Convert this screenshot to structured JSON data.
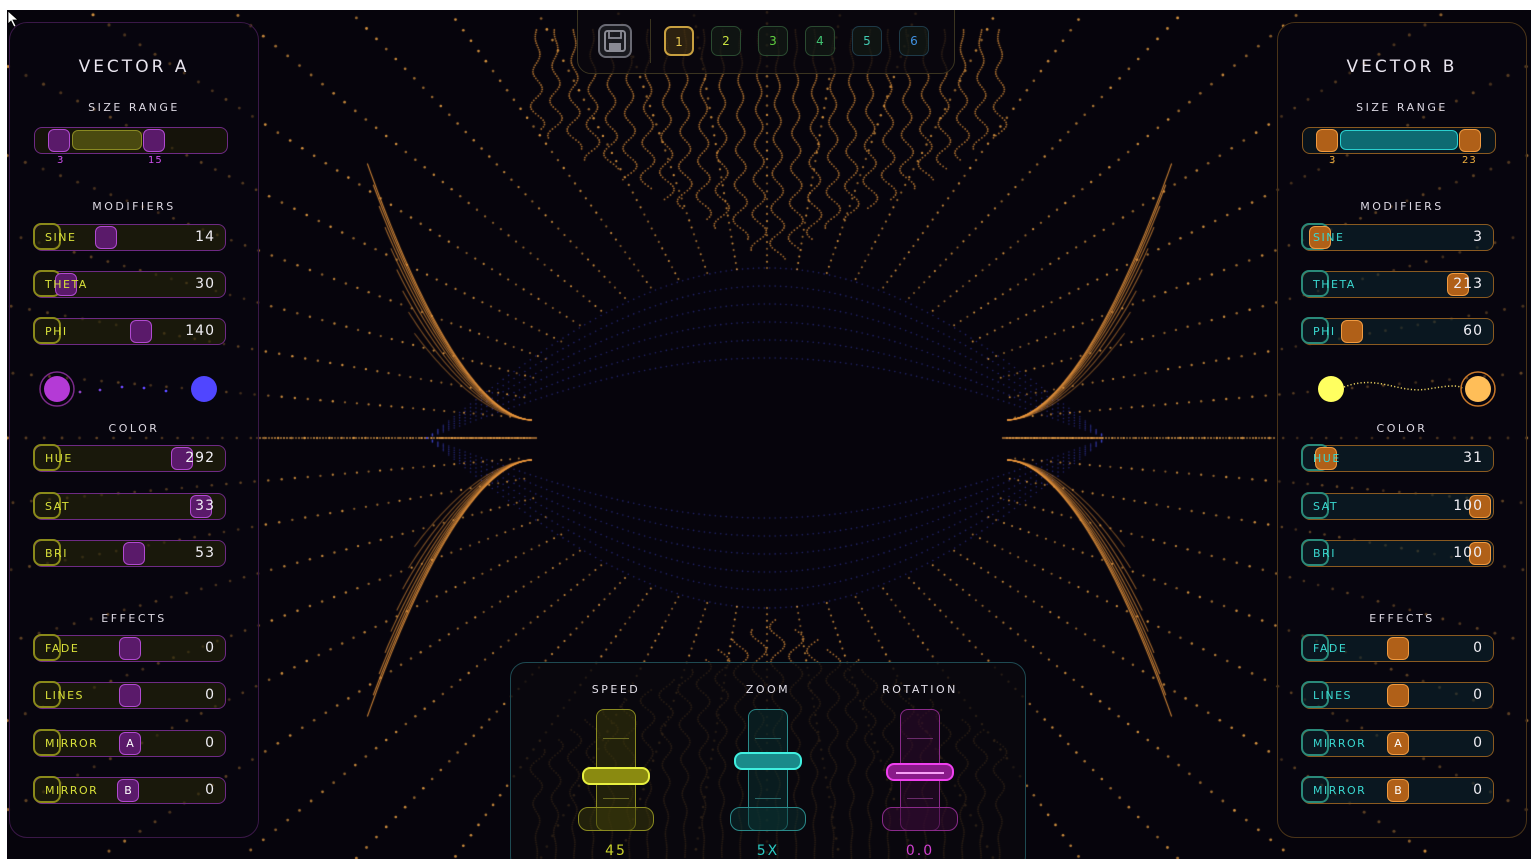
{
  "vector_a": {
    "title": "VECTOR A",
    "size_range": {
      "label": "SIZE RANGE",
      "min": "3",
      "max": "15"
    },
    "modifiers_label": "MODIFIERS",
    "modifiers": [
      {
        "label": "SINE",
        "value": "14"
      },
      {
        "label": "THETA",
        "value": "30"
      },
      {
        "label": "PHI",
        "value": "140"
      }
    ],
    "color_label": "COLOR",
    "color_start": "#b43ad6",
    "color_end": "#5046ff",
    "color": [
      {
        "label": "HUE",
        "value": "292"
      },
      {
        "label": "SAT",
        "value": "33"
      },
      {
        "label": "BRI",
        "value": "53"
      }
    ],
    "effects_label": "EFFECTS",
    "effects": [
      {
        "label": "FADE",
        "value": "0"
      },
      {
        "label": "LINES",
        "value": "0"
      },
      {
        "label": "MIRROR",
        "knob": "A",
        "value": "0"
      },
      {
        "label": "MIRROR",
        "knob": "B",
        "value": "0"
      }
    ]
  },
  "vector_b": {
    "title": "VECTOR B",
    "size_range": {
      "label": "SIZE RANGE",
      "min": "3",
      "max": "23"
    },
    "modifiers_label": "MODIFIERS",
    "modifiers": [
      {
        "label": "SINE",
        "value": "3"
      },
      {
        "label": "THETA",
        "value": "213"
      },
      {
        "label": "PHI",
        "value": "60"
      }
    ],
    "color_label": "COLOR",
    "color_start": "#ffff60",
    "color_end": "#ffbe58",
    "color": [
      {
        "label": "HUE",
        "value": "31"
      },
      {
        "label": "SAT",
        "value": "100"
      },
      {
        "label": "BRI",
        "value": "100"
      }
    ],
    "effects_label": "EFFECTS",
    "effects": [
      {
        "label": "FADE",
        "value": "0"
      },
      {
        "label": "LINES",
        "value": "0"
      },
      {
        "label": "MIRROR",
        "knob": "A",
        "value": "0"
      },
      {
        "label": "MIRROR",
        "knob": "B",
        "value": "0"
      }
    ]
  },
  "presets": {
    "save_icon": "save-icon",
    "items": [
      {
        "label": "1",
        "color": "#e8c850"
      },
      {
        "label": "2",
        "color": "#c8e040"
      },
      {
        "label": "3",
        "color": "#60d040"
      },
      {
        "label": "4",
        "color": "#40c070"
      },
      {
        "label": "5",
        "color": "#40c8b0"
      },
      {
        "label": "6",
        "color": "#4090e0"
      }
    ]
  },
  "bottom": {
    "speed": {
      "label": "SPEED",
      "value": "45",
      "color": "#c8d02a"
    },
    "zoom": {
      "label": "ZOOM",
      "value": "5X",
      "color": "#2ac8c0"
    },
    "rotation": {
      "label": "ROTATION",
      "value": "0.0",
      "color": "#d040d0"
    }
  }
}
